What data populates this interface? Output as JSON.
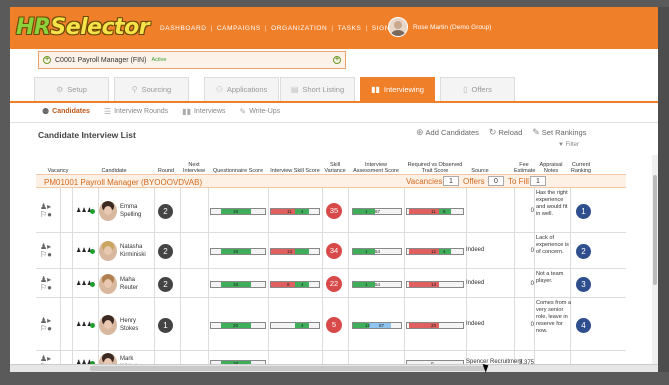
{
  "header": {
    "logo_hr": "HR",
    "logo_rest": "Selector",
    "nav": [
      "DASHBOARD",
      "CAMPAIGNS",
      "ORGANIZATION",
      "TASKS",
      "SIGN-OUT"
    ],
    "user_name": "Rose Martin (Demo Group)"
  },
  "job": {
    "title": "C0001 Payroll Manager (FIN)",
    "status": "Active"
  },
  "tabs": [
    "Setup",
    "Sourcing",
    "Applications",
    "Short Listing",
    "Interviewing",
    "Offers"
  ],
  "active_tab": "Interviewing",
  "subtabs": [
    "Candidates",
    "Interview Rounds",
    "Interviews",
    "Write-Ups"
  ],
  "active_subtab": "Candidates",
  "list_title": "Candidate Interview List",
  "actions": {
    "add": "Add Candidates",
    "reload": "Reload",
    "rankings": "Set Rankings",
    "filter": "Filter"
  },
  "columns": {
    "vacancy": "Vacancy",
    "candidate": "Candidate",
    "round": "Round",
    "next_interview": "Next Interview",
    "questionnaire": "Questionnaire Score",
    "skill_score": "Interview Skill Score",
    "skill_variance": "Skill Variance",
    "assessment": "Interview Assessment Score",
    "trait": "Required vs Observed Trait Score",
    "source": "Source",
    "fee": "Fee Estimate",
    "notes": "Appraisal Notes",
    "ranking": "Current Ranking"
  },
  "opening": {
    "title": "PM01001 Payroll Manager (BYOOOVDVAB)",
    "vacancies_label": "Vacancies",
    "vacancies": "1",
    "offers_label": "Offers",
    "offers": "0",
    "to_fill_label": "To Fill",
    "to_fill": "1"
  },
  "rows": [
    {
      "first": "Emma",
      "last": "Spelling",
      "round": "2",
      "q": "18",
      "s1": "11",
      "s2": "4",
      "variance": "35",
      "a1": "1",
      "a2": "67",
      "t1": "11",
      "t2": "8",
      "source": "",
      "fee": "0",
      "notes": "Has the right experience and would fit in well.",
      "rank": "1"
    },
    {
      "first": "Natasha",
      "last": "Kirminiski",
      "round": "2",
      "q": "18",
      "s1": "14",
      "s2": "",
      "variance": "34",
      "a1": "1",
      "a2": "54",
      "t1": "12",
      "t2": "4",
      "source": "Indeed",
      "fee": "0",
      "notes": "Lack of experience is of concern.",
      "rank": "2"
    },
    {
      "first": "Maha",
      "last": "Reuter",
      "round": "2",
      "q": "18",
      "s1": "8",
      "s2": "4",
      "variance": "22",
      "a1": "1",
      "a2": "54",
      "t1": "13",
      "t2": "",
      "source": "Indeed",
      "fee": "0",
      "notes": "Not a team player.",
      "rank": "3"
    },
    {
      "first": "Henry",
      "last": "Stokes",
      "round": "1",
      "q": "20",
      "s1": "",
      "s2": "4",
      "variance": "5",
      "a1": "12",
      "a2": "87",
      "t1": "20",
      "t2": "",
      "source": "Indeed",
      "fee": "0",
      "notes": "Comes from a very senior role, leave in reserve for now.",
      "rank": "4"
    },
    {
      "first": "Mark",
      "last": "Whitehouse",
      "round": "",
      "q": "18",
      "s1": "",
      "s2": "",
      "variance": "",
      "a1": "",
      "a2": "",
      "t1": "0",
      "t2": "",
      "source": "Spencer Recruitment",
      "fee": "3,375",
      "notes": "",
      "rank": ""
    }
  ],
  "colors": {
    "brand": "#f07f2a",
    "rank": "#2f4e8e",
    "variance": "#d84a4a",
    "bar_green": "#3fae5a",
    "bar_red": "#e06060"
  }
}
